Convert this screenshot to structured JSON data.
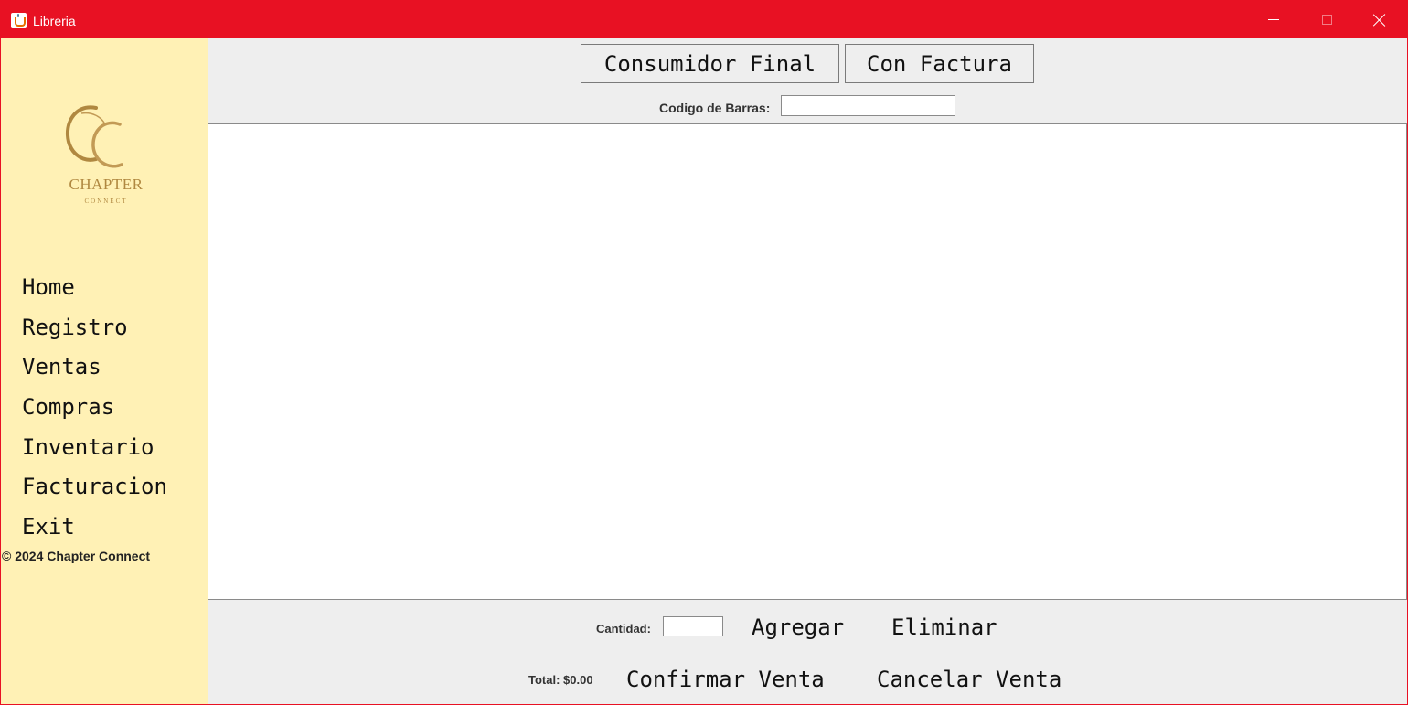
{
  "window": {
    "title": "Libreria",
    "accent_color": "#e81123",
    "controls": [
      "minimize-icon",
      "maximize-icon",
      "close-icon"
    ]
  },
  "sidebar": {
    "background": "#fff1b5",
    "logo": {
      "main_text": "CHAPTER",
      "sub_text": "CONNECT"
    },
    "items": [
      {
        "label": "Home"
      },
      {
        "label": "Registro"
      },
      {
        "label": "Ventas"
      },
      {
        "label": "Compras"
      },
      {
        "label": "Inventario"
      },
      {
        "label": "Facturacion"
      },
      {
        "label": "Exit"
      }
    ],
    "copyright": "© 2024 Chapter Connect"
  },
  "main": {
    "buttons": {
      "consumidor_final": "Consumidor Final",
      "con_factura": "Con Factura"
    },
    "barcode": {
      "label": "Codigo de Barras:",
      "value": ""
    },
    "cantidad": {
      "label": "Cantidad:",
      "value": ""
    },
    "agregar_label": "Agregar",
    "eliminar_label": "Eliminar",
    "total_label": "Total: $0.00",
    "confirmar_label": "Confirmar Venta",
    "cancelar_label": "Cancelar Venta"
  }
}
